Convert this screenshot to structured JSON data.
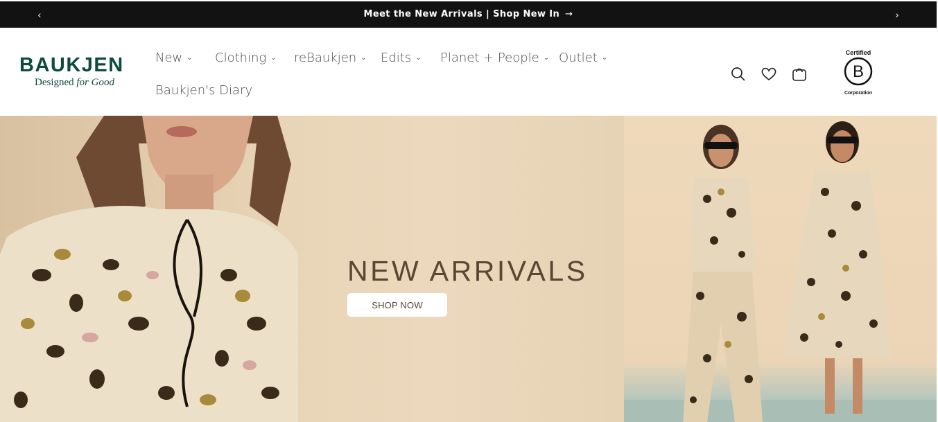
{
  "announcement": {
    "text": "Meet the New Arrivals | Shop New In",
    "arrow": "→",
    "prev_icon": "‹",
    "next_icon": "›"
  },
  "header": {
    "logo": {
      "wordmark": "BAUKJEN",
      "tagline_prefix": "Designed ",
      "tagline_italic": "for Good"
    },
    "nav": [
      {
        "label": "New",
        "has_dropdown": true
      },
      {
        "label": "Clothing",
        "has_dropdown": true
      },
      {
        "label": "reBaukjen",
        "has_dropdown": true
      },
      {
        "label": "Edits",
        "has_dropdown": true
      },
      {
        "label": "Planet + People",
        "has_dropdown": true
      },
      {
        "label": "Outlet",
        "has_dropdown": true
      },
      {
        "label": "Baukjen's Diary",
        "has_dropdown": false
      }
    ],
    "icons": [
      "search-icon",
      "heart-icon",
      "bag-icon"
    ],
    "badge": {
      "top": "Certified",
      "letter": "B",
      "bottom": "Corporation"
    }
  },
  "hero": {
    "title": "NEW ARRIVALS",
    "button_label": "SHOP NOW"
  },
  "colors": {
    "announce_bg": "#121212",
    "brand_green": "#0e4a3d",
    "hero_text": "#5a4632",
    "hero_bg": "#e8d4b6"
  }
}
